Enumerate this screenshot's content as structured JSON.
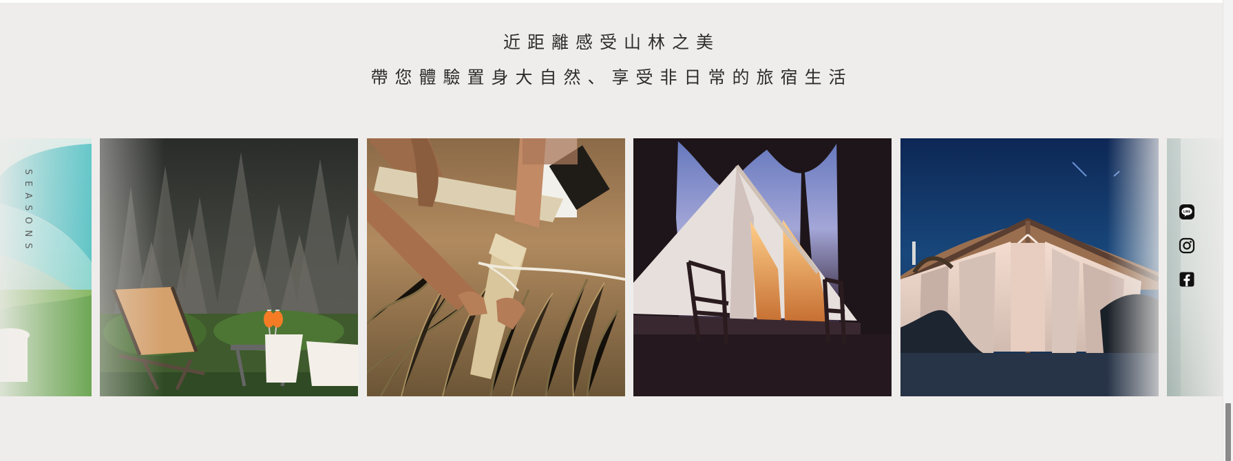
{
  "headline": {
    "line1": "近距離感受山林之美",
    "line2": "帶您體驗置身大自然、享受非日常的旅宿生活"
  },
  "gallery": {
    "side_label": "SEASONS",
    "photos": [
      {
        "subject": "teal tent and grass"
      },
      {
        "subject": "folding chairs and cocktails by forest"
      },
      {
        "subject": "hands driving wooden tent stake"
      },
      {
        "subject": "bell tent glowing at dusk"
      },
      {
        "subject": "canvas safari tent under night sky"
      },
      {
        "subject": "blurred side image"
      }
    ]
  },
  "social": {
    "items": [
      {
        "name": "line",
        "label": "LINE"
      },
      {
        "name": "instagram",
        "label": ""
      },
      {
        "name": "facebook",
        "label": ""
      }
    ]
  },
  "colors": {
    "background": "#efedeb",
    "text": "#2d2d2d",
    "icon": "#111111"
  }
}
